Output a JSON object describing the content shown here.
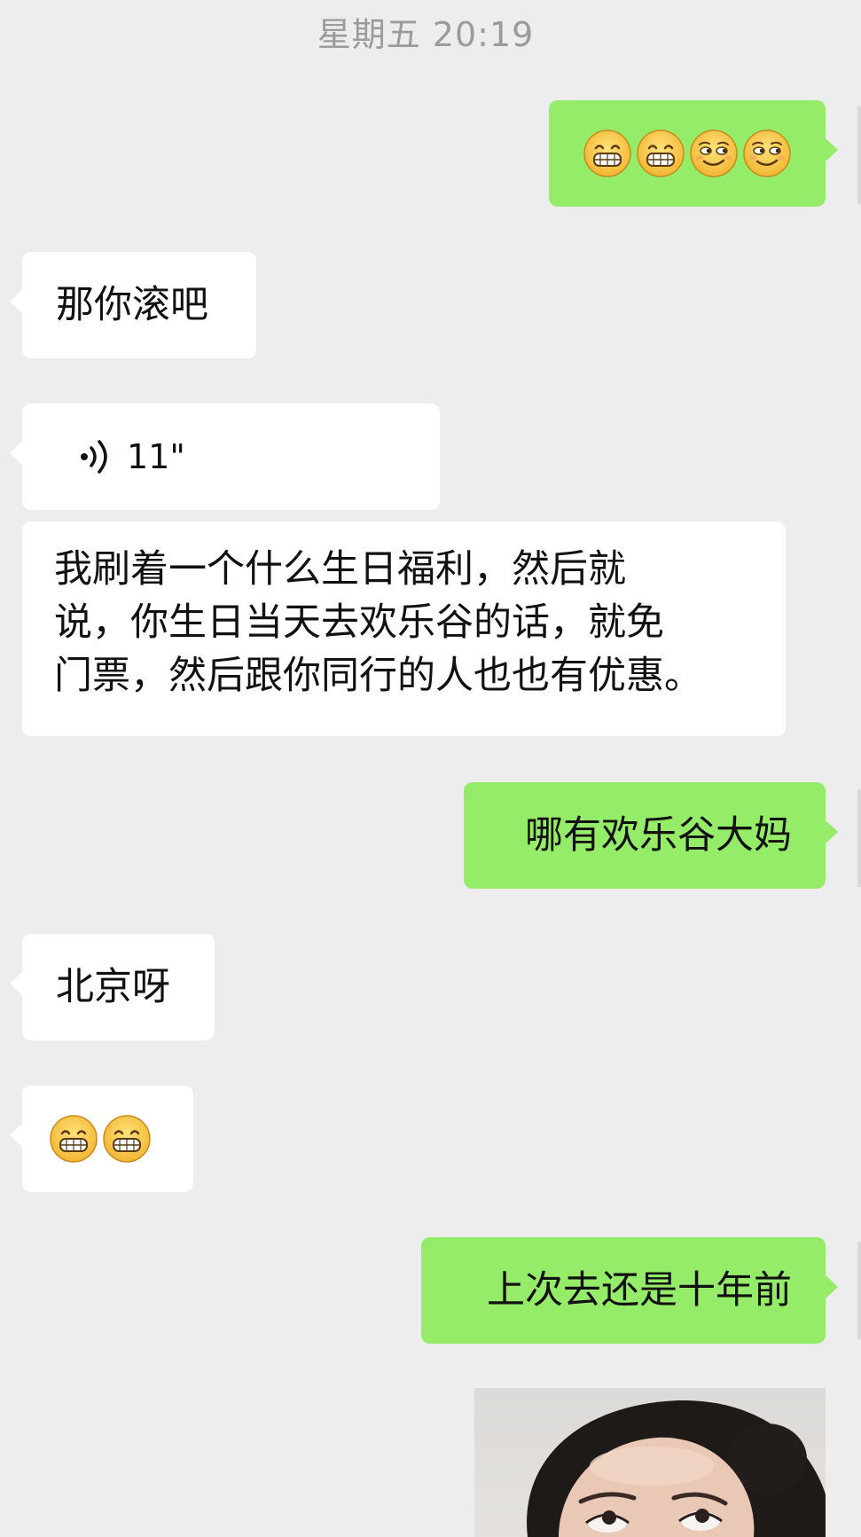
{
  "chat": {
    "timestamp": "星期五 20:19",
    "messages": [
      {
        "side": "out",
        "type": "emoji",
        "emoji": [
          "grin-face",
          "grin-face",
          "smirk-face",
          "smirk-face"
        ]
      },
      {
        "side": "in",
        "type": "text",
        "text": "那你滚吧"
      },
      {
        "side": "in",
        "type": "voice",
        "duration": "11\""
      },
      {
        "side": "in",
        "type": "text",
        "lines": [
          "我刷着一个什么生日福利，然后就",
          "说，你生日当天去欢乐谷的话，就免",
          "门票，然后跟你同行的人也也有优惠。"
        ]
      },
      {
        "side": "out",
        "type": "text",
        "text": "哪有欢乐谷大妈"
      },
      {
        "side": "in",
        "type": "text",
        "text": "北京呀"
      },
      {
        "side": "in",
        "type": "emoji",
        "emoji": [
          "grin-face",
          "grin-face"
        ]
      },
      {
        "side": "out",
        "type": "text",
        "text": "上次去还是十年前"
      },
      {
        "side": "out",
        "type": "image",
        "image": "photo-of-woman"
      }
    ]
  },
  "colors": {
    "background": "#ededed",
    "incoming_bubble": "#ffffff",
    "outgoing_bubble": "#95ec69",
    "timestamp_text": "#9b9b9b"
  }
}
